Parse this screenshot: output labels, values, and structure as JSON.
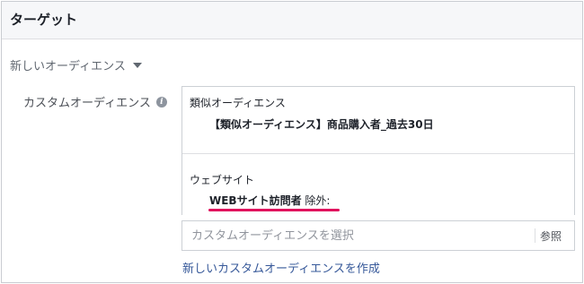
{
  "header": {
    "title": "ターゲット"
  },
  "section": {
    "toggle_label": "新しいオーディエンス"
  },
  "custom_audience": {
    "label": "カスタムオーディエンス",
    "groups": [
      {
        "title": "類似オーディエンス",
        "item": "【類似オーディエンス】商品購入者_過去30日"
      },
      {
        "title": "ウェブサイト",
        "item_name": "WEBサイト訪問者",
        "item_suffix": "除外:"
      }
    ],
    "search_placeholder": "カスタムオーディエンスを選択",
    "browse_label": "参照",
    "create_link": "新しいカスタムオーディエンスを作成"
  },
  "colors": {
    "annotation_underline": "#e0125d",
    "link": "#365899",
    "header_bg": "#f6f7f9"
  }
}
